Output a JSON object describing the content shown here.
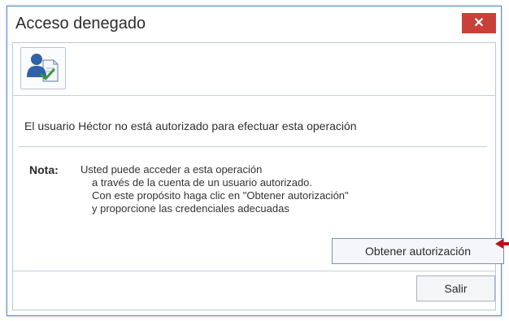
{
  "window": {
    "title": "Acceso denegado",
    "close_label": "✕"
  },
  "icon": {
    "name": "user-authorization-icon"
  },
  "message": "El usuario Héctor no está autorizado para efectuar esta operación",
  "note": {
    "label": "Nota:",
    "lines": [
      "Usted puede acceder a esta operación",
      "a través de la cuenta de un usuario autorizado.",
      "Con este propósito haga clic en \"Obtener autorización\"",
      "y proporcione las credenciales adecuadas"
    ]
  },
  "buttons": {
    "authorize_label": "Obtener autorización",
    "exit_label": "Salir"
  },
  "colors": {
    "close_button": "#c9403a",
    "window_border": "#4f8fd6",
    "annotation_arrow": "#c0101a"
  }
}
